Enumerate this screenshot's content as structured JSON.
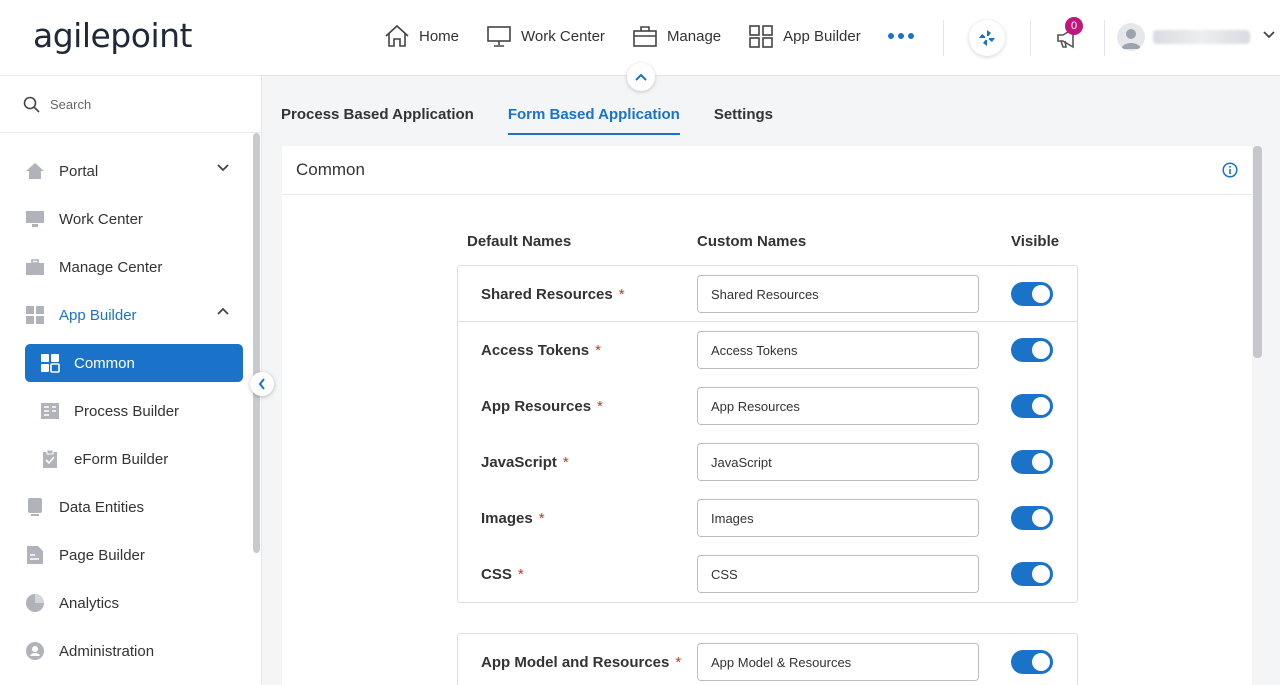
{
  "header": {
    "logo": "agilepoint",
    "nav": [
      {
        "label": "Home",
        "icon": "home-icon"
      },
      {
        "label": "Work Center",
        "icon": "monitor-icon"
      },
      {
        "label": "Manage",
        "icon": "briefcase-icon"
      },
      {
        "label": "App Builder",
        "icon": "grid-icon"
      }
    ],
    "notification_count": "0"
  },
  "sidebar": {
    "search_placeholder": "Search",
    "items": [
      {
        "label": "Portal",
        "icon": "home-icon"
      },
      {
        "label": "Work Center",
        "icon": "monitor-icon"
      },
      {
        "label": "Manage Center",
        "icon": "briefcase-icon"
      },
      {
        "label": "App Builder",
        "icon": "grid-icon"
      },
      {
        "label": "Common",
        "icon": "grid-icon"
      },
      {
        "label": "Process Builder",
        "icon": "process-icon"
      },
      {
        "label": "eForm Builder",
        "icon": "clipboard-icon"
      },
      {
        "label": "Data Entities",
        "icon": "database-icon"
      },
      {
        "label": "Page Builder",
        "icon": "page-icon"
      },
      {
        "label": "Analytics",
        "icon": "pie-chart-icon"
      },
      {
        "label": "Administration",
        "icon": "admin-icon"
      }
    ]
  },
  "tabs": [
    "Process Based Application",
    "Form Based Application",
    "Settings"
  ],
  "section": {
    "title": "Common",
    "columns": {
      "default": "Default Names",
      "custom": "Custom Names",
      "visible": "Visible"
    },
    "rows": [
      {
        "name": "Shared Resources",
        "custom": "Shared Resources",
        "visible": true
      },
      {
        "name": "Access Tokens",
        "custom": "Access Tokens",
        "visible": true
      },
      {
        "name": "App Resources",
        "custom": "App Resources",
        "visible": true
      },
      {
        "name": "JavaScript",
        "custom": "JavaScript",
        "visible": true
      },
      {
        "name": "Images",
        "custom": "Images",
        "visible": true
      },
      {
        "name": "CSS",
        "custom": "CSS",
        "visible": true
      }
    ],
    "rows2": [
      {
        "name": "App Model and Resources",
        "custom": "App Model & Resources",
        "visible": true
      }
    ],
    "required_mark": "*"
  }
}
